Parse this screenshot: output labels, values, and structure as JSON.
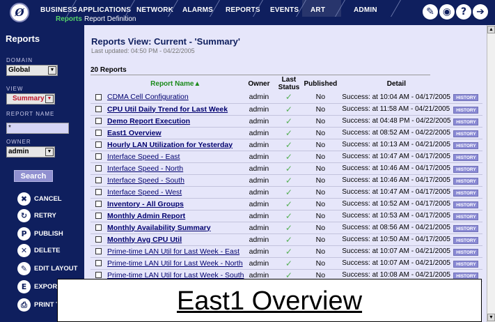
{
  "nav": {
    "logo_glyph": "Ø",
    "tabs": [
      {
        "label": "BUSINESS",
        "active": false
      },
      {
        "label": "APPLICATIONS",
        "active": false
      },
      {
        "label": "NETWORK",
        "active": false
      },
      {
        "label": "ALARMS",
        "active": false
      },
      {
        "label": "REPORTS",
        "active": false
      },
      {
        "label": "EVENTS",
        "active": false
      },
      {
        "label": "ART",
        "active": true
      },
      {
        "label": "ADMIN",
        "active": false
      }
    ],
    "sub_current": "Reports",
    "sub_definition": "Report Definition",
    "utility_icons": [
      "wrench-icon",
      "globe-icon",
      "help-icon",
      "logout-icon"
    ]
  },
  "sidebar": {
    "title": "Reports",
    "domain_label": "DOMAIN",
    "domain_value": "Global",
    "view_label": "VIEW",
    "view_value": "Summary",
    "report_name_label": "REPORT NAME",
    "report_name_value": "*",
    "owner_label": "OWNER",
    "owner_value": "admin",
    "search_label": "Search",
    "actions": [
      {
        "label": "CANCEL",
        "icon": "cancel-icon"
      },
      {
        "label": "RETRY",
        "icon": "retry-icon"
      },
      {
        "label": "PUBLISH",
        "icon": "publish-icon"
      },
      {
        "label": "DELETE",
        "icon": "delete-icon"
      },
      {
        "label": "EDIT LAYOUT",
        "icon": "edit-layout-icon"
      },
      {
        "label": "EXPORT",
        "icon": "export-icon"
      },
      {
        "label": "PRINT T",
        "icon": "print-icon"
      }
    ]
  },
  "main": {
    "title": "Reports View: Current - 'Summary'",
    "updated": "Last updated: 04:50 PM - 04/22/2005",
    "count": "20 Reports",
    "columns": {
      "name": "Report Name▲",
      "owner": "Owner",
      "status": "Last Status",
      "published": "Published",
      "detail": "Detail"
    },
    "history_label": "HISTORY",
    "status_glyph": "✓",
    "rows": [
      {
        "name": "CDMA Cell Configuration",
        "bold": false,
        "owner": "admin",
        "published": "No",
        "detail": "Success: at 10:04 AM - 04/17/2005"
      },
      {
        "name": "CPU Util Daily Trend for Last Week",
        "bold": true,
        "owner": "admin",
        "published": "No",
        "detail": "Success: at 11:58 AM - 04/21/2005"
      },
      {
        "name": "Demo Report Execution",
        "bold": true,
        "owner": "admin",
        "published": "No",
        "detail": "Success: at 04:48 PM - 04/22/2005"
      },
      {
        "name": "East1 Overview",
        "bold": true,
        "owner": "admin",
        "published": "No",
        "detail": "Success: at 08:52 AM - 04/22/2005"
      },
      {
        "name": "Hourly LAN Utilization for Yesterday",
        "bold": true,
        "owner": "admin",
        "published": "No",
        "detail": "Success: at 10:13 AM - 04/21/2005"
      },
      {
        "name": "Interface Speed - East",
        "bold": false,
        "owner": "admin",
        "published": "No",
        "detail": "Success: at 10:47 AM - 04/17/2005"
      },
      {
        "name": "Interface Speed - North",
        "bold": false,
        "owner": "admin",
        "published": "No",
        "detail": "Success: at 10:46 AM - 04/17/2005"
      },
      {
        "name": "Interface Speed - South",
        "bold": false,
        "owner": "admin",
        "published": "No",
        "detail": "Success: at 10:46 AM - 04/17/2005"
      },
      {
        "name": "Interface Speed - West",
        "bold": false,
        "owner": "admin",
        "published": "No",
        "detail": "Success: at 10:47 AM - 04/17/2005"
      },
      {
        "name": "Inventory - All Groups",
        "bold": true,
        "owner": "admin",
        "published": "No",
        "detail": "Success: at 10:52 AM - 04/17/2005"
      },
      {
        "name": "Monthly Admin Report",
        "bold": true,
        "owner": "admin",
        "published": "No",
        "detail": "Success: at 10:53 AM - 04/17/2005"
      },
      {
        "name": "Monthly Availability Summary",
        "bold": true,
        "owner": "admin",
        "published": "No",
        "detail": "Success: at 08:56 AM - 04/21/2005"
      },
      {
        "name": "Monthly Avg CPU Util",
        "bold": true,
        "owner": "admin",
        "published": "No",
        "detail": "Success: at 10:50 AM - 04/17/2005"
      },
      {
        "name": "Prime-time LAN Util for Last Week - East",
        "bold": false,
        "owner": "admin",
        "published": "No",
        "detail": "Success: at 10:07 AM - 04/21/2005"
      },
      {
        "name": "Prime-time LAN Util for Last Week - North",
        "bold": false,
        "owner": "admin",
        "published": "No",
        "detail": "Success: at 10:07 AM - 04/21/2005"
      },
      {
        "name": "Prime-time LAN Util for Last Week - South",
        "bold": false,
        "owner": "admin",
        "published": "No",
        "detail": "Success: at 10:08 AM - 04/21/2005"
      }
    ]
  },
  "tooltip": {
    "text": "East1 Overview"
  }
}
